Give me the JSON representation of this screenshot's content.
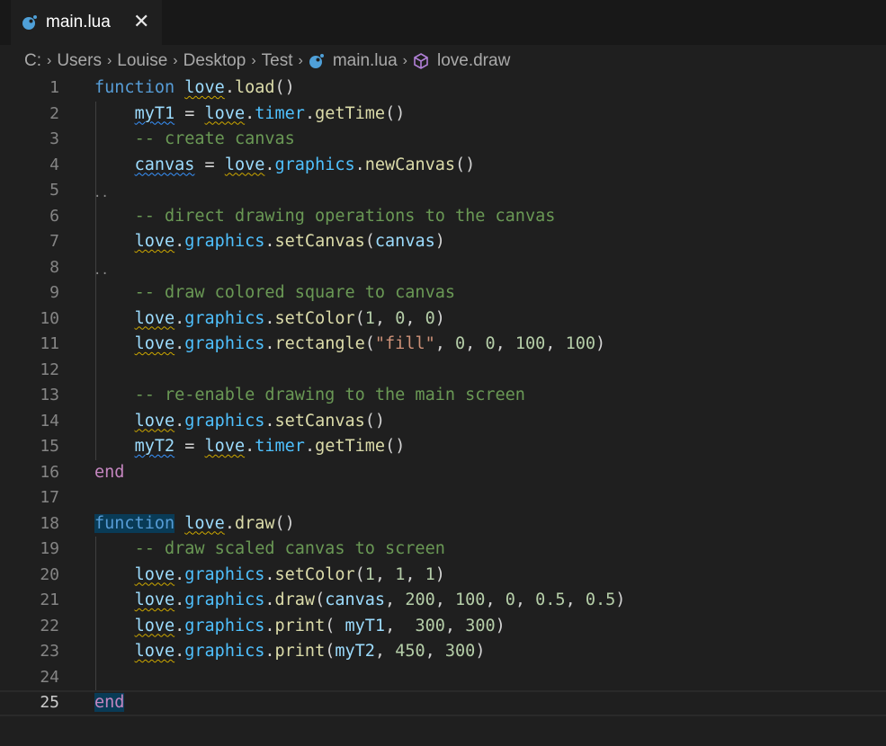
{
  "tab": {
    "label": "main.lua",
    "close": "✕",
    "icon": "lua-file-icon"
  },
  "breadcrumb": {
    "parts": [
      "C:",
      "Users",
      "Louise",
      "Desktop",
      "Test",
      "main.lua",
      "love.draw"
    ],
    "separator": "›"
  },
  "colors": {
    "background": "#1f1f1f",
    "keyword": "#c586c0",
    "function_kw": "#569cd6",
    "comment": "#6a9955",
    "number": "#b5cea8",
    "string": "#ce9178"
  },
  "editor": {
    "active_line": 25,
    "lines": [
      {
        "n": "1"
      },
      {
        "n": "2"
      },
      {
        "n": "3"
      },
      {
        "n": "4"
      },
      {
        "n": "5"
      },
      {
        "n": "6"
      },
      {
        "n": "7"
      },
      {
        "n": "8"
      },
      {
        "n": "9"
      },
      {
        "n": "10"
      },
      {
        "n": "11"
      },
      {
        "n": "12"
      },
      {
        "n": "13"
      },
      {
        "n": "14"
      },
      {
        "n": "15"
      },
      {
        "n": "16"
      },
      {
        "n": "17"
      },
      {
        "n": "18"
      },
      {
        "n": "19"
      },
      {
        "n": "20"
      },
      {
        "n": "21"
      },
      {
        "n": "22"
      },
      {
        "n": "23"
      },
      {
        "n": "24"
      },
      {
        "n": "25"
      }
    ],
    "code": {
      "l1": {
        "kw": "function",
        "obj": "love",
        "fn": "load",
        "rest": "()"
      },
      "l2": {
        "var": "myT1",
        "eq": " = ",
        "obj": "love",
        "mem": "timer",
        "fn": "getTime",
        "rest": "()"
      },
      "l3": {
        "cmt": "-- create canvas"
      },
      "l4": {
        "var": "canvas",
        "eq": " = ",
        "obj": "love",
        "mem": "graphics",
        "fn": "newCanvas",
        "rest": "()"
      },
      "l6": {
        "cmt": "-- direct drawing operations to the canvas"
      },
      "l7": {
        "obj": "love",
        "mem": "graphics",
        "fn": "setCanvas",
        "open": "(",
        "arg": "canvas",
        "close": ")"
      },
      "l9": {
        "cmt": "-- draw colored square to canvas"
      },
      "l10": {
        "obj": "love",
        "mem": "graphics",
        "fn": "setColor",
        "open": "(",
        "a1": "1",
        "c1": ", ",
        "a2": "0",
        "c2": ", ",
        "a3": "0",
        "close": ")"
      },
      "l11": {
        "obj": "love",
        "mem": "graphics",
        "fn": "rectangle",
        "open": "(",
        "s": "\"fill\"",
        "c0": ", ",
        "a1": "0",
        "c1": ", ",
        "a2": "0",
        "c2": ", ",
        "a3": "100",
        "c3": ", ",
        "a4": "100",
        "close": ")"
      },
      "l13": {
        "cmt": "-- re-enable drawing to the main screen"
      },
      "l14": {
        "obj": "love",
        "mem": "graphics",
        "fn": "setCanvas",
        "rest": "()"
      },
      "l15": {
        "var": "myT2",
        "eq": " = ",
        "obj": "love",
        "mem": "timer",
        "fn": "getTime",
        "rest": "()"
      },
      "l16": {
        "kw": "end"
      },
      "l18": {
        "kw": "function",
        "obj": "love",
        "fn": "draw",
        "rest": "()"
      },
      "l19": {
        "cmt": "-- draw scaled canvas to screen"
      },
      "l20": {
        "obj": "love",
        "mem": "graphics",
        "fn": "setColor",
        "open": "(",
        "a1": "1",
        "c1": ", ",
        "a2": "1",
        "c2": ", ",
        "a3": "1",
        "close": ")"
      },
      "l21": {
        "obj": "love",
        "mem": "graphics",
        "fn": "draw",
        "open": "(",
        "arg": "canvas",
        "c0": ", ",
        "a1": "200",
        "c1": ", ",
        "a2": "100",
        "c2": ", ",
        "a3": "0",
        "c3": ", ",
        "a4": "0.5",
        "c4": ", ",
        "a5": "0.5",
        "close": ")"
      },
      "l22": {
        "obj": "love",
        "mem": "graphics",
        "fn": "print",
        "open": "( ",
        "arg": "myT1",
        "c0": ",  ",
        "a1": "300",
        "c1": ", ",
        "a2": "300",
        "close": ")"
      },
      "l23": {
        "obj": "love",
        "mem": "graphics",
        "fn": "print",
        "open": "(",
        "arg": "myT2",
        "c0": ", ",
        "a1": "450",
        "c1": ", ",
        "a2": "300",
        "close": ")"
      },
      "l25": {
        "kw": "end"
      }
    }
  }
}
